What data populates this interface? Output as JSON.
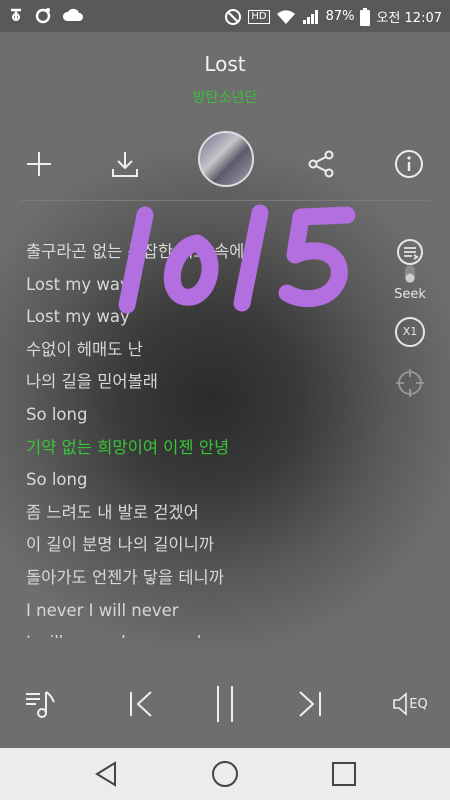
{
  "status_bar": {
    "battery_text": "87%",
    "time_text": "오전 12:07",
    "hd_label": "HD"
  },
  "song": {
    "title": "Lost",
    "artist": "방탄소년단"
  },
  "lyrics": {
    "lines": [
      "출구라곤 없는 복잡한 미로 속에",
      "Lost my way",
      "Lost my way",
      "수없이 헤매도 난",
      "나의 길을 믿어볼래",
      "So long",
      "기약 없는 희망이여 이젠 안녕",
      "So long",
      "좀 느려도 내 발로 걷겠어",
      "이 길이 분명 나의 길이니까",
      "돌아가도 언젠가 닿을 테니까",
      "I never I will never",
      "I will never lose my dream"
    ],
    "current_index": 6
  },
  "side_controls": {
    "seek_label": "Seek",
    "speed_label": "X1"
  },
  "eq_label": "EQ",
  "overlay_text": "1015",
  "colors": {
    "accent_green": "#37c53a",
    "handwriting_purple": "#b36ee0"
  }
}
